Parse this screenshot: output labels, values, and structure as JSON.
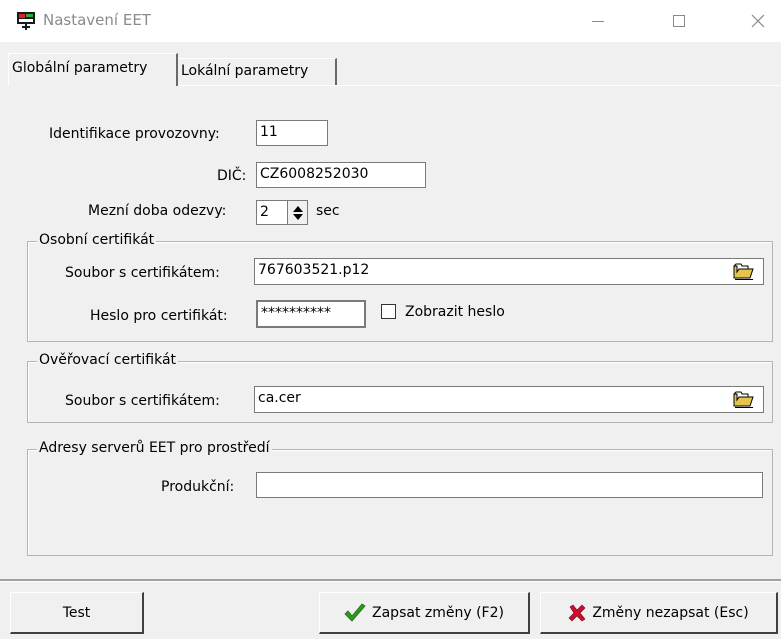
{
  "window": {
    "title": "Nastavení EET",
    "icon": "eet-app-icon"
  },
  "tabs": [
    {
      "label": "Globální parametry",
      "active": true
    },
    {
      "label": "Lokální parametry",
      "active": false
    }
  ],
  "form": {
    "identifikace": {
      "label": "Identifikace provozovny:",
      "value": "11"
    },
    "dic": {
      "label": "DIČ:",
      "value": "CZ6008252030"
    },
    "mezni_doba": {
      "label": "Mezní doba odezvy:",
      "value": "2",
      "unit": "sec"
    }
  },
  "osobni_certifikat": {
    "title": "Osobní certifikát",
    "soubor_label": "Soubor s certifikátem:",
    "soubor_value": "767603521.p12",
    "heslo_label": "Heslo pro certifikát:",
    "heslo_value": "**********",
    "zobrazit_label": "Zobrazit heslo",
    "zobrazit_checked": false
  },
  "overovaci_certifikat": {
    "title": "Ověřovací certifikát",
    "soubor_label": "Soubor s certifikátem:",
    "soubor_value": "ca.cer"
  },
  "adresy": {
    "title": "Adresy serverů EET pro prostředí",
    "produkcni_label": "Produkční:",
    "produkcni_value": ""
  },
  "buttons": {
    "test": "Test",
    "zapsat": "Zapsat změny (F2)",
    "nezapsat": "Změny nezapsat (Esc)"
  },
  "colors": {
    "check_green": "#2f9a1e",
    "cross_red": "#c8102e",
    "folder_yellow": "#e8c34a"
  }
}
